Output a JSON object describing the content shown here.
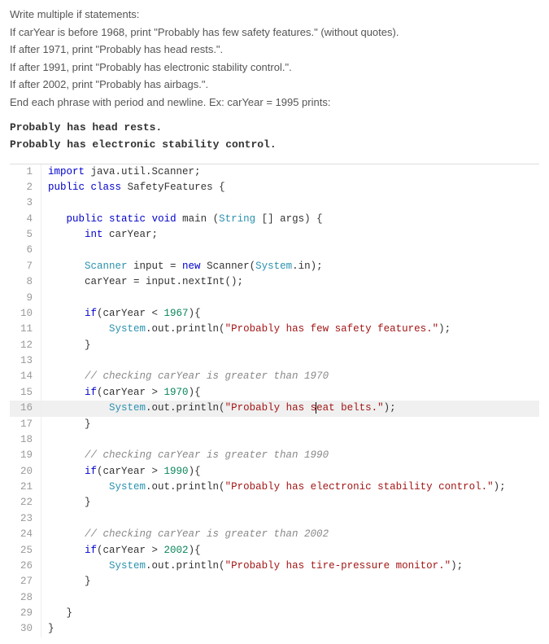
{
  "instructions": {
    "l1": "Write multiple if statements:",
    "l2": "If carYear is before 1968, print \"Probably has few safety features.\" (without quotes).",
    "l3": "If after 1971, print \"Probably has head rests.\".",
    "l4": "If after 1991, print \"Probably has electronic stability control.\".",
    "l5": "If after 2002, print \"Probably has airbags.\".",
    "l6": "End each phrase with period and newline. Ex: carYear = 1995 prints:"
  },
  "example": {
    "l1": "Probably has head rests.",
    "l2": "Probably has electronic stability control."
  },
  "code": {
    "n1": "1",
    "n2": "2",
    "n3": "3",
    "n4": "4",
    "n5": "5",
    "n6": "6",
    "n7": "7",
    "n8": "8",
    "n9": "9",
    "n10": "10",
    "n11": "11",
    "n12": "12",
    "n13": "13",
    "n14": "14",
    "n15": "15",
    "n16": "16",
    "n17": "17",
    "n18": "18",
    "n19": "19",
    "n20": "20",
    "n21": "21",
    "n22": "22",
    "n23": "23",
    "n24": "24",
    "n25": "25",
    "n26": "26",
    "n27": "27",
    "n28": "28",
    "n29": "29",
    "n30": "30",
    "kw_import": "import",
    "pkg_java_util": " java.util.Scanner;",
    "kw_public": "public",
    "kw_class": "class",
    "cls_name": "SafetyFeatures",
    "brace_open": " {",
    "kw_static": "static",
    "kw_void": "void",
    "main": "main",
    "paren_open": " (",
    "cls_string": "String",
    "args_decl": " [] args) {",
    "kw_int": "int",
    "var_caryear": " carYear;",
    "cls_scanner": "Scanner",
    "input_eq": " input = ",
    "kw_new": "new",
    "scanner_ctor1": " Scanner(",
    "cls_system": "System",
    "dot_in": ".in);",
    "assign_caryear": "      carYear = input.nextInt();",
    "kw_if": "if",
    "cond1_a": "(carYear < ",
    "num_1967": "1967",
    "cond_close": "){",
    "sout": "System",
    "dot_out_println": ".out.println(",
    "str1": "\"Probably has few safety features.\"",
    "close_stmt": ");",
    "brace_close_i": "      }",
    "com1": "// checking carYear is greater than 1970",
    "cond2_a": "(carYear > ",
    "num_1970": "1970",
    "str2a": "\"Probably has s",
    "str2b": "eat belts.\"",
    "com2": "// checking carYear is greater than 1990",
    "num_1990": "1990",
    "str3": "\"Probably has electronic stability control.\"",
    "com3": "// checking carYear is greater than 2002",
    "num_2002": "2002",
    "str4": "\"Probably has tire-pressure monitor.\"",
    "method_close": "   }",
    "class_close": "}"
  }
}
